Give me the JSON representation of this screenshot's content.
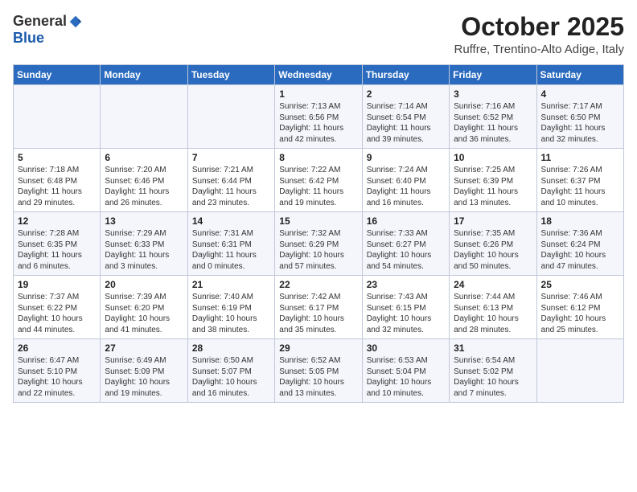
{
  "header": {
    "logo_general": "General",
    "logo_blue": "Blue",
    "month_title": "October 2025",
    "location": "Ruffre, Trentino-Alto Adige, Italy"
  },
  "days_of_week": [
    "Sunday",
    "Monday",
    "Tuesday",
    "Wednesday",
    "Thursday",
    "Friday",
    "Saturday"
  ],
  "weeks": [
    [
      {
        "day": "",
        "info": ""
      },
      {
        "day": "",
        "info": ""
      },
      {
        "day": "",
        "info": ""
      },
      {
        "day": "1",
        "info": "Sunrise: 7:13 AM\nSunset: 6:56 PM\nDaylight: 11 hours and 42 minutes."
      },
      {
        "day": "2",
        "info": "Sunrise: 7:14 AM\nSunset: 6:54 PM\nDaylight: 11 hours and 39 minutes."
      },
      {
        "day": "3",
        "info": "Sunrise: 7:16 AM\nSunset: 6:52 PM\nDaylight: 11 hours and 36 minutes."
      },
      {
        "day": "4",
        "info": "Sunrise: 7:17 AM\nSunset: 6:50 PM\nDaylight: 11 hours and 32 minutes."
      }
    ],
    [
      {
        "day": "5",
        "info": "Sunrise: 7:18 AM\nSunset: 6:48 PM\nDaylight: 11 hours and 29 minutes."
      },
      {
        "day": "6",
        "info": "Sunrise: 7:20 AM\nSunset: 6:46 PM\nDaylight: 11 hours and 26 minutes."
      },
      {
        "day": "7",
        "info": "Sunrise: 7:21 AM\nSunset: 6:44 PM\nDaylight: 11 hours and 23 minutes."
      },
      {
        "day": "8",
        "info": "Sunrise: 7:22 AM\nSunset: 6:42 PM\nDaylight: 11 hours and 19 minutes."
      },
      {
        "day": "9",
        "info": "Sunrise: 7:24 AM\nSunset: 6:40 PM\nDaylight: 11 hours and 16 minutes."
      },
      {
        "day": "10",
        "info": "Sunrise: 7:25 AM\nSunset: 6:39 PM\nDaylight: 11 hours and 13 minutes."
      },
      {
        "day": "11",
        "info": "Sunrise: 7:26 AM\nSunset: 6:37 PM\nDaylight: 11 hours and 10 minutes."
      }
    ],
    [
      {
        "day": "12",
        "info": "Sunrise: 7:28 AM\nSunset: 6:35 PM\nDaylight: 11 hours and 6 minutes."
      },
      {
        "day": "13",
        "info": "Sunrise: 7:29 AM\nSunset: 6:33 PM\nDaylight: 11 hours and 3 minutes."
      },
      {
        "day": "14",
        "info": "Sunrise: 7:31 AM\nSunset: 6:31 PM\nDaylight: 11 hours and 0 minutes."
      },
      {
        "day": "15",
        "info": "Sunrise: 7:32 AM\nSunset: 6:29 PM\nDaylight: 10 hours and 57 minutes."
      },
      {
        "day": "16",
        "info": "Sunrise: 7:33 AM\nSunset: 6:27 PM\nDaylight: 10 hours and 54 minutes."
      },
      {
        "day": "17",
        "info": "Sunrise: 7:35 AM\nSunset: 6:26 PM\nDaylight: 10 hours and 50 minutes."
      },
      {
        "day": "18",
        "info": "Sunrise: 7:36 AM\nSunset: 6:24 PM\nDaylight: 10 hours and 47 minutes."
      }
    ],
    [
      {
        "day": "19",
        "info": "Sunrise: 7:37 AM\nSunset: 6:22 PM\nDaylight: 10 hours and 44 minutes."
      },
      {
        "day": "20",
        "info": "Sunrise: 7:39 AM\nSunset: 6:20 PM\nDaylight: 10 hours and 41 minutes."
      },
      {
        "day": "21",
        "info": "Sunrise: 7:40 AM\nSunset: 6:19 PM\nDaylight: 10 hours and 38 minutes."
      },
      {
        "day": "22",
        "info": "Sunrise: 7:42 AM\nSunset: 6:17 PM\nDaylight: 10 hours and 35 minutes."
      },
      {
        "day": "23",
        "info": "Sunrise: 7:43 AM\nSunset: 6:15 PM\nDaylight: 10 hours and 32 minutes."
      },
      {
        "day": "24",
        "info": "Sunrise: 7:44 AM\nSunset: 6:13 PM\nDaylight: 10 hours and 28 minutes."
      },
      {
        "day": "25",
        "info": "Sunrise: 7:46 AM\nSunset: 6:12 PM\nDaylight: 10 hours and 25 minutes."
      }
    ],
    [
      {
        "day": "26",
        "info": "Sunrise: 6:47 AM\nSunset: 5:10 PM\nDaylight: 10 hours and 22 minutes."
      },
      {
        "day": "27",
        "info": "Sunrise: 6:49 AM\nSunset: 5:09 PM\nDaylight: 10 hours and 19 minutes."
      },
      {
        "day": "28",
        "info": "Sunrise: 6:50 AM\nSunset: 5:07 PM\nDaylight: 10 hours and 16 minutes."
      },
      {
        "day": "29",
        "info": "Sunrise: 6:52 AM\nSunset: 5:05 PM\nDaylight: 10 hours and 13 minutes."
      },
      {
        "day": "30",
        "info": "Sunrise: 6:53 AM\nSunset: 5:04 PM\nDaylight: 10 hours and 10 minutes."
      },
      {
        "day": "31",
        "info": "Sunrise: 6:54 AM\nSunset: 5:02 PM\nDaylight: 10 hours and 7 minutes."
      },
      {
        "day": "",
        "info": ""
      }
    ]
  ]
}
